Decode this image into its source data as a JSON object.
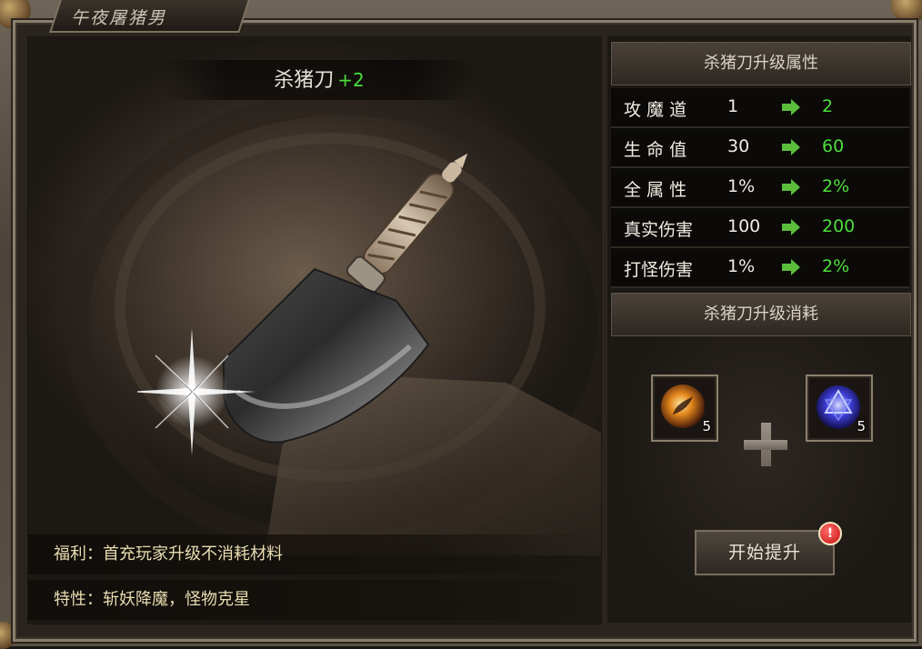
{
  "window": {
    "title": "午夜屠猪男"
  },
  "item": {
    "name": "杀猪刀",
    "level_suffix": "+2"
  },
  "info": {
    "benefit": "福利：首充玩家升级不消耗材料",
    "trait": "特性：斩妖降魔，怪物克星"
  },
  "attributes": {
    "header": "杀猪刀升级属性",
    "rows": [
      {
        "label": "攻 魔 道",
        "current": "1",
        "next": "2"
      },
      {
        "label": "生 命 值",
        "current": "30",
        "next": "60"
      },
      {
        "label": "全 属 性",
        "current": "1%",
        "next": "2%"
      },
      {
        "label": "真实伤害",
        "current": "100",
        "next": "200"
      },
      {
        "label": "打怪伤害",
        "current": "1%",
        "next": "2%"
      }
    ]
  },
  "cost": {
    "header": "杀猪刀升级消耗",
    "materials": [
      {
        "icon": "fire-orb-icon",
        "count": "5"
      },
      {
        "icon": "blue-crystal-icon",
        "count": "5"
      }
    ]
  },
  "actions": {
    "upgrade_label": "开始提升",
    "notice_badge": "!"
  },
  "colors": {
    "upgrade_value": "#4cde3b",
    "panel_bg": "#1b1713",
    "accent_border": "#8b806c"
  }
}
